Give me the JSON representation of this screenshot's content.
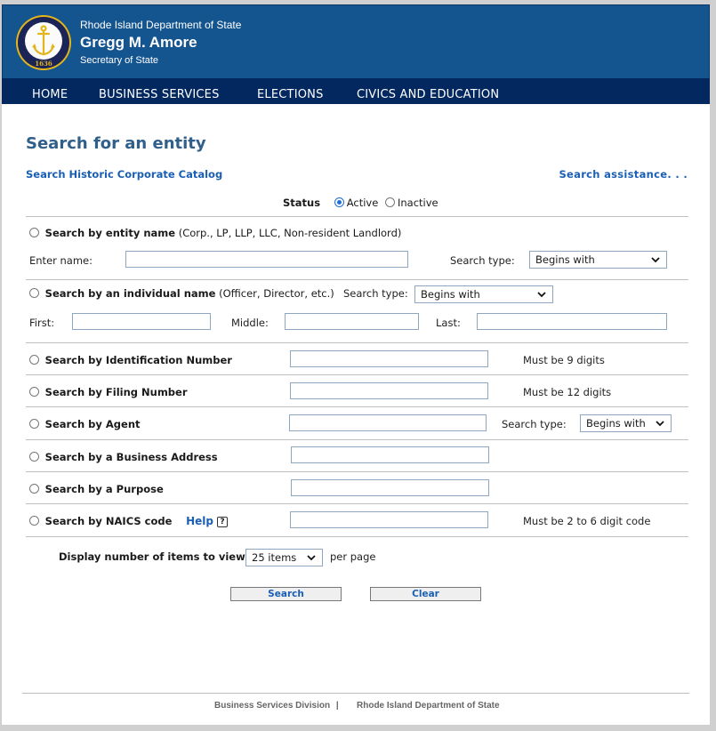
{
  "header": {
    "organization": "Rhode Island Department of State",
    "official_name": "Gregg M. Amore",
    "official_title": "Secretary of State",
    "seal_year": "1636",
    "colors": {
      "banner": "#14548f",
      "nav": "#03285f",
      "seal_ring": "#e3b51c"
    }
  },
  "nav": {
    "items": [
      {
        "label": "HOME"
      },
      {
        "label": "BUSINESS SERVICES"
      },
      {
        "label": "ELECTIONS"
      },
      {
        "label": "CIVICS AND EDUCATION"
      }
    ]
  },
  "page": {
    "title": "Search for an entity",
    "historic_link": "Search Historic Corporate Catalog",
    "assistance_link": "Search assistance. . ."
  },
  "status": {
    "label": "Status",
    "options": [
      {
        "label": "Active",
        "checked": true
      },
      {
        "label": "Inactive",
        "checked": false
      }
    ]
  },
  "search_options": {
    "entity_name": {
      "label": "Search by entity name",
      "hint": "(Corp., LP, LLP, LLC, Non-resident Landlord)",
      "enter_name_label": "Enter name:",
      "enter_name_value": "",
      "search_type_label": "Search type:",
      "search_type_value": "Begins with"
    },
    "individual_name": {
      "label": "Search by an individual name",
      "hint": "(Officer, Director, etc.)",
      "search_type_label": "Search type:",
      "search_type_value": "Begins with",
      "first_label": "First:",
      "middle_label": "Middle:",
      "last_label": "Last:",
      "first_value": "",
      "middle_value": "",
      "last_value": ""
    },
    "identification_number": {
      "label": "Search by Identification Number",
      "value": "",
      "note": "Must be 9 digits"
    },
    "filing_number": {
      "label": "Search by Filing Number",
      "value": "",
      "note": "Must be 12 digits"
    },
    "agent": {
      "label": "Search by Agent",
      "value": "",
      "search_type_label": "Search type:",
      "search_type_value": "Begins with"
    },
    "business_address": {
      "label": "Search by a Business Address",
      "value": ""
    },
    "purpose": {
      "label": "Search by a Purpose",
      "value": ""
    },
    "naics": {
      "label": "Search by NAICS code",
      "help_label": "Help",
      "help_icon": "question-mark-box",
      "value": "",
      "note": "Must be 2 to 6 digit code"
    }
  },
  "pagination": {
    "label": "Display number of items to view:",
    "value": "25 items",
    "suffix": "per page"
  },
  "buttons": {
    "search": "Search",
    "clear": "Clear"
  },
  "footer": {
    "division": "Business Services Division",
    "separator": "|",
    "department": "Rhode Island Department of State"
  }
}
